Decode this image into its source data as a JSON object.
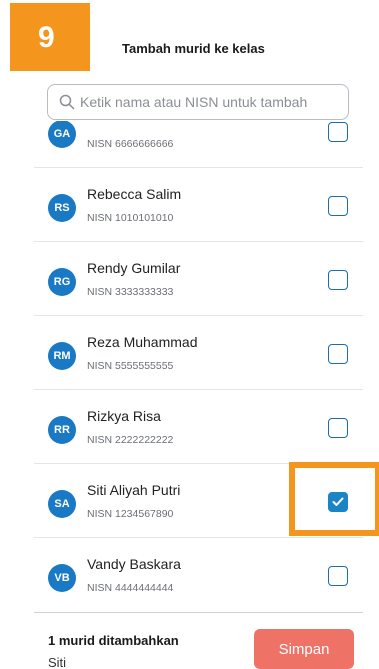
{
  "step_number": "9",
  "header": {
    "title": "Tambah murid ke kelas"
  },
  "search": {
    "placeholder": "Ketik nama atau NISN untuk tambah",
    "value": ""
  },
  "students": [
    {
      "initials": "GA",
      "name": "",
      "nisn": "NISN 6666666666",
      "selected": false
    },
    {
      "initials": "RS",
      "name": "Rebecca Salim",
      "nisn": "NISN 1010101010",
      "selected": false
    },
    {
      "initials": "RG",
      "name": "Rendy Gumilar",
      "nisn": "NISN 3333333333",
      "selected": false
    },
    {
      "initials": "RM",
      "name": "Reza Muhammad",
      "nisn": "NISN 5555555555",
      "selected": false
    },
    {
      "initials": "RR",
      "name": "Rizkya Risa",
      "nisn": "NISN 2222222222",
      "selected": false
    },
    {
      "initials": "SA",
      "name": "Siti Aliyah Putri",
      "nisn": "NISN 1234567890",
      "selected": true
    },
    {
      "initials": "VB",
      "name": "Vandy Baskara",
      "nisn": "NISN 4444444444",
      "selected": false
    }
  ],
  "footer": {
    "count_label": "1 murid ditambahkan",
    "selected_names": "Siti",
    "save_label": "Simpan"
  },
  "colors": {
    "accent_orange": "#f4961e",
    "avatar_blue": "#1979c4",
    "checkbox_blue": "#1b84c6",
    "save_button": "#ee7266"
  },
  "icons": {
    "search": "search-icon",
    "check": "check-icon"
  }
}
